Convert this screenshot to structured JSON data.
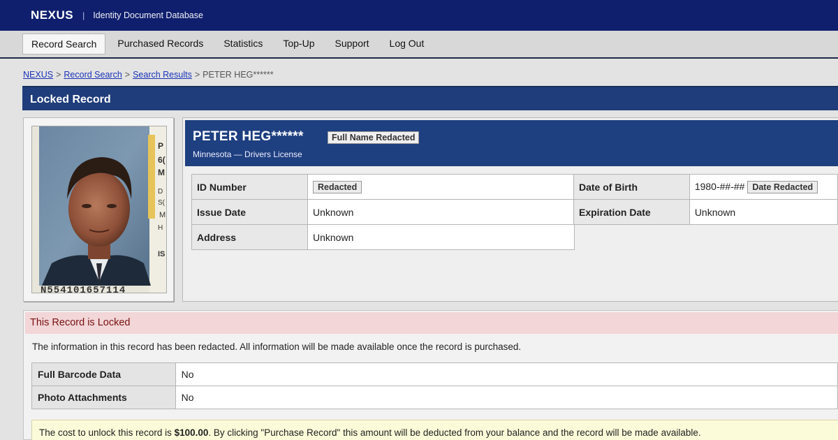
{
  "header": {
    "brand": "NEXUS",
    "separator": "|",
    "subtitle": "Identity Document Database"
  },
  "nav": {
    "items": [
      {
        "label": "Record Search",
        "active": true
      },
      {
        "label": "Purchased Records"
      },
      {
        "label": "Statistics"
      },
      {
        "label": "Top-Up"
      },
      {
        "label": "Support"
      },
      {
        "label": "Log Out"
      }
    ]
  },
  "breadcrumb": {
    "items": [
      "NEXUS",
      "Record Search",
      "Search Results"
    ],
    "current": "PETER HEG******",
    "separator": ">"
  },
  "record": {
    "title": "Locked Record",
    "name": "PETER HEG******",
    "name_badge": "Full Name Redacted",
    "subtitle": "Minnesota — Drivers License",
    "photo_text": {
      "lines": [
        "P",
        "6(",
        "M",
        "D",
        "S(",
        "M",
        "H",
        "IS"
      ],
      "barcode": "N554101657114"
    },
    "fields_left": [
      {
        "label": "ID Number",
        "value": "",
        "badge": "Redacted"
      },
      {
        "label": "Issue Date",
        "value": "Unknown"
      },
      {
        "label": "Address",
        "value": "Unknown"
      }
    ],
    "fields_right": [
      {
        "label": "Date of Birth",
        "value": "1980-##-##",
        "badge": "Date Redacted"
      },
      {
        "label": "Expiration Date",
        "value": "Unknown"
      }
    ]
  },
  "locked": {
    "title": "This Record is Locked",
    "message": "The information in this record has been redacted. All information will be made available once the record is purchased.",
    "rows": [
      {
        "label": "Full Barcode Data",
        "value": "No"
      },
      {
        "label": "Photo Attachments",
        "value": "No"
      }
    ],
    "cost_prefix": "The cost to unlock this record is ",
    "cost_amount": "$100.00",
    "cost_suffix": ". By clicking \"Purchase Record\" this amount will be deducted from your balance and the record will be made available."
  },
  "colors": {
    "topbar": "#0f1f6e",
    "title_bar": "#1f3d7a",
    "locked_header_bg": "#f2d6d8",
    "locked_header_text": "#7a1010",
    "cost_bg": "#fcfbd9"
  }
}
